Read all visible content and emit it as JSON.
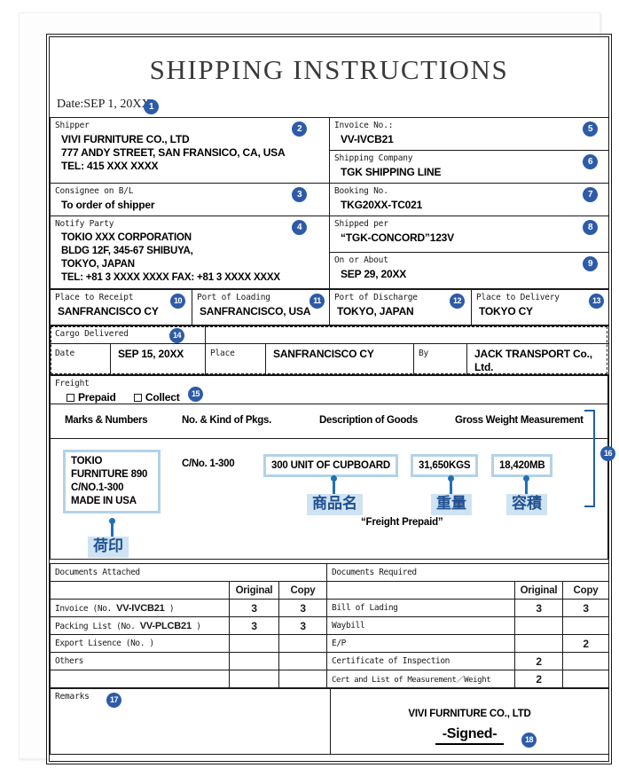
{
  "document": {
    "title": "SHIPPING INSTRUCTIONS",
    "date_line": "Date:SEP 1, 20XX"
  },
  "colors": {
    "badge_blue": "#2d5ba8",
    "highlight_border": "#b3d2e8",
    "jp_label_bg": "#cfe3f2",
    "jp_label_text": "#1f4f91",
    "connector_blue": "#1f6fb8"
  },
  "parties": {
    "shipper": {
      "label": "Shipper",
      "badge": "2",
      "value": "VIVI FURNITURE CO., LTD\n777 ANDY STREET, SAN FRANSICO, CA, USA\nTEL: 415 XXX XXXX"
    },
    "consignee": {
      "label": "Consignee on B/L",
      "badge": "3",
      "value": "To order of shipper"
    },
    "notify": {
      "label": "Notify Party",
      "badge": "4",
      "value": "TOKIO XXX CORPORATION\nBLDG 12F, 345-67 SHIBUYA,\nTOKYO, JAPAN\nTEL: +81 3 XXXX XXXX FAX: +81 3 XXXX XXXX"
    }
  },
  "booking": {
    "invoice_no": {
      "label": "Invoice No.:",
      "badge": "5",
      "value": "VV-IVCB21"
    },
    "shipping_company": {
      "label": "Shipping Company",
      "badge": "6",
      "value": "TGK SHIPPING LINE"
    },
    "booking_no": {
      "label": "Booking No.",
      "badge": "7",
      "value": "TKG20XX-TC021"
    },
    "shipped_per": {
      "label": "Shipped per",
      "badge": "8",
      "value": "“TGK-CONCORD”123V"
    },
    "on_or_about": {
      "label": "On or About",
      "badge": "9",
      "value": "SEP 29, 20XX"
    }
  },
  "routing": [
    {
      "label": "Place to Receipt",
      "badge": "10",
      "value": "SANFRANCISCO CY"
    },
    {
      "label": "Port of Loading",
      "badge": "11",
      "value": "SANFRANCISCO, USA"
    },
    {
      "label": "Port of Discharge",
      "badge": "12",
      "value": "TOKYO, JAPAN"
    },
    {
      "label": "Place to Delivery",
      "badge": "13",
      "value": "TOKYO CY"
    }
  ],
  "cargo_delivered": {
    "label": "Cargo Delivered",
    "badge": "14",
    "date_label": "Date",
    "date_value": "SEP 15, 20XX",
    "place_label": "Place",
    "place_value": "SANFRANCISCO CY",
    "by_label": "By",
    "by_value": "JACK TRANSPORT Co., Ltd."
  },
  "freight": {
    "label": "Freight",
    "badge": "15",
    "options": [
      "Prepaid",
      "Collect"
    ]
  },
  "cargo": {
    "badge": "16",
    "headers": [
      "Marks & Numbers",
      "No. & Kind of Pkgs.",
      "Description of Goods",
      "Gross Weight Measurement"
    ],
    "marks": "TOKIO\nFURNITURE 890\nC/NO.1-300\nMADE IN USA",
    "marks_jp": "荷印",
    "pkgs": "C/No. 1-300",
    "description": "300 UNIT OF CUPBOARD",
    "description_jp": "商品名",
    "gross_weight": "31,650KGS",
    "gross_weight_jp": "重量",
    "measurement": "18,420MB",
    "measurement_jp": "容積",
    "freight_note": "“Freight Prepaid”"
  },
  "documents": {
    "attached_title": "Documents Attached",
    "required_title": "Documents Required",
    "col_original": "Original",
    "col_copy": "Copy",
    "attached_rows": [
      {
        "name_pre": "Invoice (No. ",
        "name_bold": "VV-IVCB21",
        "name_post": " )",
        "original": "3",
        "copy": "3"
      },
      {
        "name_pre": "Packing List (No. ",
        "name_bold": "VV-PLCB21",
        "name_post": " )",
        "original": "3",
        "copy": "3"
      },
      {
        "name_pre": "Export Lisence (No.",
        "name_bold": "",
        "name_post": "           )",
        "original": "",
        "copy": ""
      },
      {
        "name_pre": "Others",
        "name_bold": "",
        "name_post": "",
        "original": "",
        "copy": ""
      },
      {
        "name_pre": "",
        "name_bold": "",
        "name_post": "",
        "original": "",
        "copy": ""
      }
    ],
    "required_rows": [
      {
        "name": "Bill of Lading",
        "original": "3",
        "copy": "3"
      },
      {
        "name": "Waybill",
        "original": "",
        "copy": ""
      },
      {
        "name": "E/P",
        "original": "",
        "copy": "2"
      },
      {
        "name": "Certificate of Inspection",
        "original": "2",
        "copy": ""
      },
      {
        "name": "Cert and List of Measurement／Weight",
        "original": "2",
        "copy": ""
      }
    ]
  },
  "footer": {
    "remarks_label": "Remarks",
    "remarks_badge": "17",
    "company": "VIVI FURNITURE CO., LTD",
    "signed": "-Signed-",
    "signed_badge": "18"
  }
}
